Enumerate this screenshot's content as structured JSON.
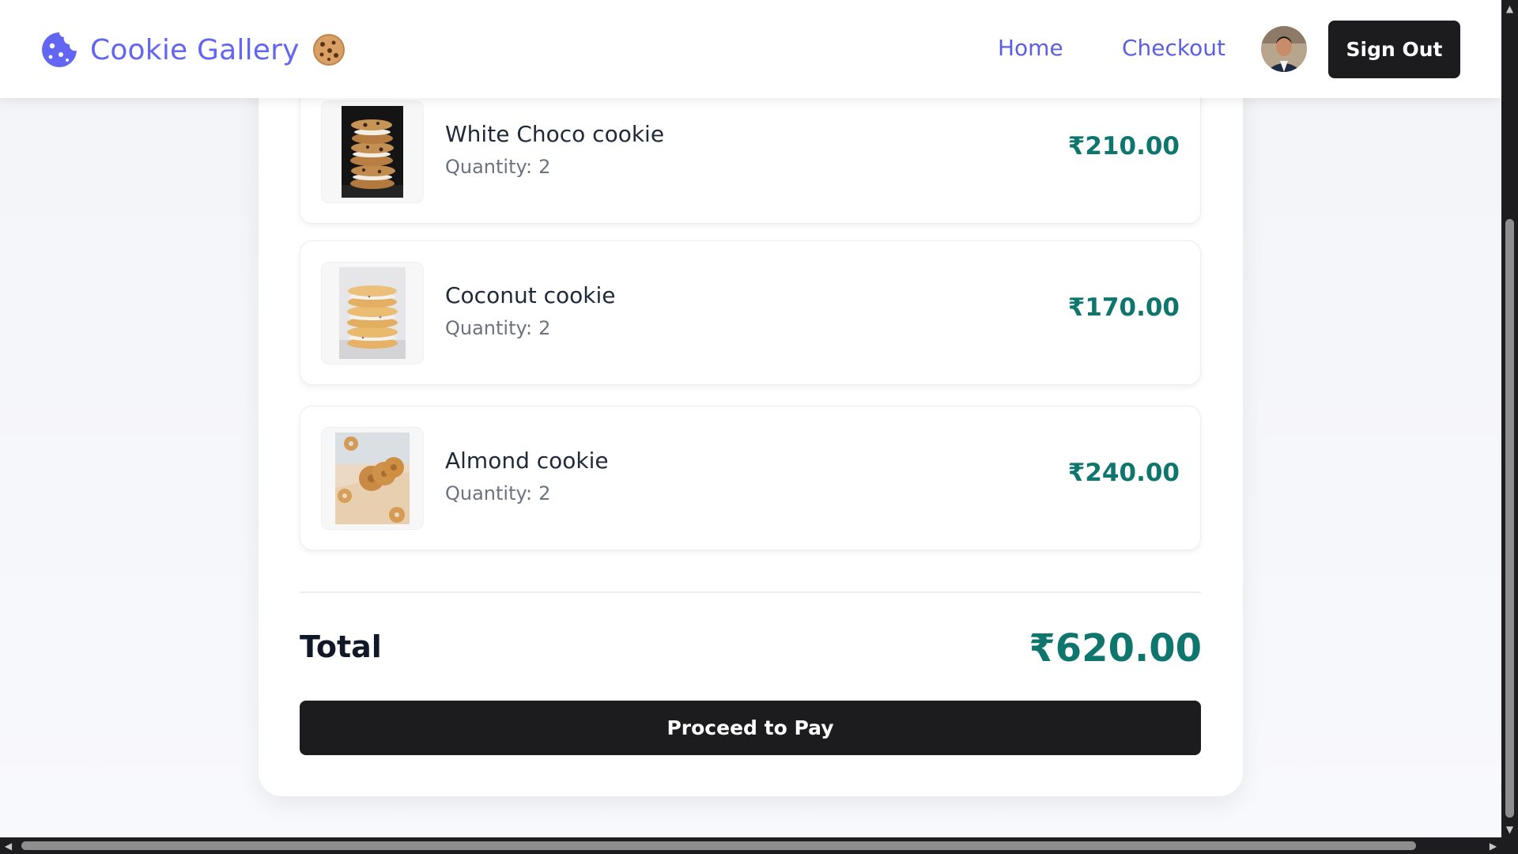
{
  "header": {
    "brand": "Cookie Gallery",
    "nav": [
      {
        "label": "Home"
      },
      {
        "label": "Checkout"
      }
    ],
    "sign_out_label": "Sign Out",
    "brand_color": "#6366f1"
  },
  "cart": {
    "items": [
      {
        "name": "White Choco cookie",
        "quantity_label": "Quantity:",
        "quantity": "2",
        "price": "₹210.00",
        "image": "stacked-cookies-image"
      },
      {
        "name": "Coconut cookie",
        "quantity_label": "Quantity:",
        "quantity": "2",
        "price": "₹170.00",
        "image": "coconut-sandwich-cookies-image"
      },
      {
        "name": "Almond cookie",
        "quantity_label": "Quantity:",
        "quantity": "2",
        "price": "₹240.00",
        "image": "almond-ring-cookies-image"
      }
    ],
    "total_label": "Total",
    "total_value": "₹620.00",
    "pay_button_label": "Proceed to Pay",
    "price_color": "#0f766e"
  }
}
